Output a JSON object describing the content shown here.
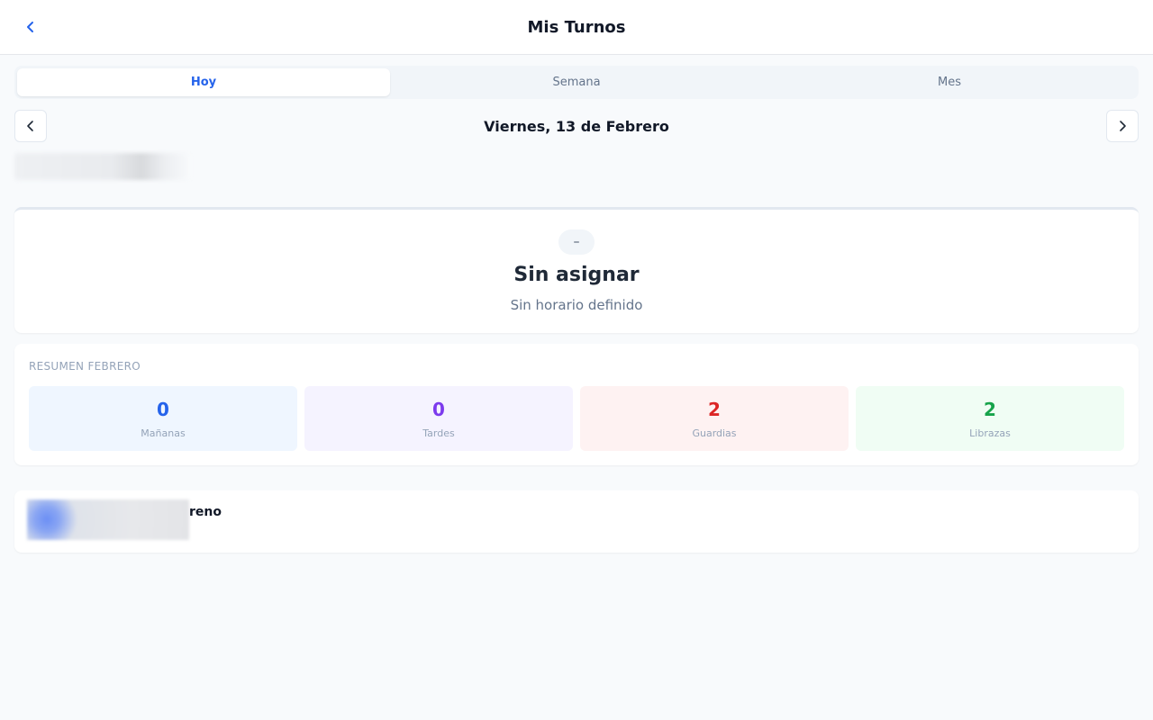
{
  "header": {
    "title": "Mis Turnos",
    "back_icon": "chevron-left-icon"
  },
  "tabs": [
    {
      "label": "Hoy",
      "active": true
    },
    {
      "label": "Semana",
      "active": false
    },
    {
      "label": "Mes",
      "active": false
    }
  ],
  "date_nav": {
    "label": "Viernes, 13 de Febrero",
    "prev_icon": "chevron-left-icon",
    "next_icon": "chevron-right-icon"
  },
  "shift": {
    "badge": "–",
    "title": "Sin asignar",
    "subtitle": "Sin horario definido"
  },
  "summary": {
    "title": "RESUMEN FEBRERO",
    "stats": [
      {
        "value": "0",
        "label": "Mañanas",
        "color": "#2563eb",
        "bg": "#eff6ff"
      },
      {
        "value": "0",
        "label": "Tardes",
        "color": "#7c3aed",
        "bg": "#f5f3ff"
      },
      {
        "value": "2",
        "label": "Guardias",
        "color": "#dc2626",
        "bg": "#fef2f2"
      },
      {
        "value": "2",
        "label": "Librazas",
        "color": "#16a34a",
        "bg": "#f0fdf4"
      }
    ]
  },
  "bottom": {
    "text": "reno"
  },
  "colors": {
    "accent": "#2563eb"
  }
}
